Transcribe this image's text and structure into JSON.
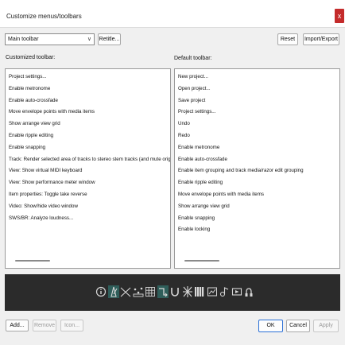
{
  "window": {
    "title": "Customize menus/toolbars",
    "close_glyph": "x"
  },
  "toolbar_select": {
    "value": "Main toolbar",
    "chevron": "∨"
  },
  "buttons": {
    "retitle": "Retitle...",
    "reset": "Reset",
    "import_export": "Import/Export",
    "add": "Add...",
    "remove": "Remove",
    "icon": "Icon...",
    "ok": "OK",
    "cancel": "Cancel",
    "apply": "Apply"
  },
  "customized": {
    "label": "Customized toolbar:",
    "items": [
      "Project settings...",
      "Enable metronome",
      "Enable auto-crossfade",
      "Move envelope points with media items",
      "Show arrange view grid",
      "Enable ripple editing",
      "Enable snapping",
      "Track: Render selected area of tracks to stereo stem tracks (and mute originals)",
      "View: Show virtual MIDI keyboard",
      "View: Show performance meter window",
      "Item properties: Toggle take reverse",
      "Video: Show/hide video window",
      "SWS/BR: Analyze loudness..."
    ]
  },
  "default": {
    "label": "Default toolbar:",
    "items": [
      "New project...",
      "Open project...",
      "Save project",
      "Project settings...",
      "Undo",
      "Redo",
      "Enable metronome",
      "Enable auto-crossfade",
      "Enable item grouping and track media/razor edit grouping",
      "Enable ripple editing",
      "Move envelope points with media items",
      "Show arrange view grid",
      "Enable snapping",
      "Enable locking"
    ]
  },
  "toolbar_icons": [
    {
      "name": "info-icon",
      "active": false
    },
    {
      "name": "metronome-icon",
      "active": true
    },
    {
      "name": "crossfade-icon",
      "active": false
    },
    {
      "name": "envelope-points-icon",
      "active": false
    },
    {
      "name": "grid-icon",
      "active": false
    },
    {
      "name": "ripple-icon",
      "active": true
    },
    {
      "name": "snap-icon",
      "active": false
    },
    {
      "name": "render-stems-icon",
      "active": false
    },
    {
      "name": "midi-keyboard-icon",
      "active": false
    },
    {
      "name": "performance-meter-icon",
      "active": false
    },
    {
      "name": "take-reverse-icon",
      "active": false
    },
    {
      "name": "video-window-icon",
      "active": false
    },
    {
      "name": "loudness-icon",
      "active": false
    }
  ],
  "colors": {
    "close_button": "#c42b2b",
    "active_icon_bg": "#2f5e5a",
    "icon_fg": "#d8d8d8",
    "primary_border": "#2a6fd6"
  }
}
